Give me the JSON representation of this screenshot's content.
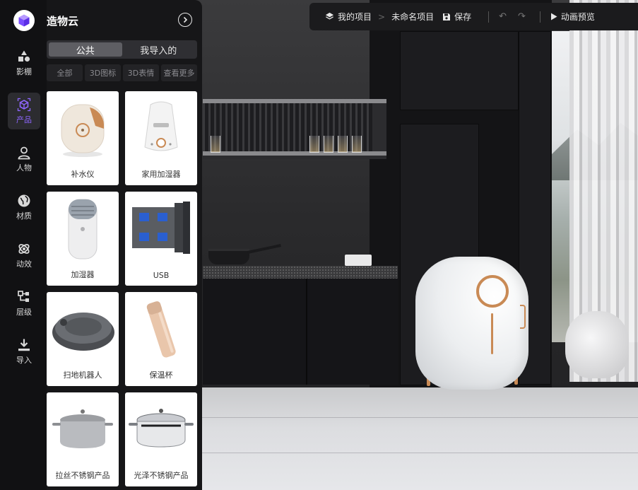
{
  "app": {
    "name": "造物云"
  },
  "toolbar": {
    "my_projects": "我的项目",
    "separator": ">",
    "project_name": "未命名项目",
    "save": "保存",
    "undo_icon": "undo-icon",
    "redo_icon": "redo-icon",
    "preview": "动画预览"
  },
  "rail": {
    "items": [
      {
        "label": "影棚",
        "icon": "studio-shapes-icon",
        "active": false
      },
      {
        "label": "产品",
        "icon": "product-cube-icon",
        "active": true
      },
      {
        "label": "人物",
        "icon": "person-icon",
        "active": false
      },
      {
        "label": "材质",
        "icon": "material-globe-icon",
        "active": false
      },
      {
        "label": "动效",
        "icon": "motion-rings-icon",
        "active": false
      },
      {
        "label": "层级",
        "icon": "hierarchy-icon",
        "active": false
      },
      {
        "label": "导入",
        "icon": "import-download-icon",
        "active": false
      }
    ],
    "accent_color": "#8e66ff"
  },
  "panel": {
    "tabs": [
      {
        "label": "公共",
        "active": true
      },
      {
        "label": "我导入的",
        "active": false
      }
    ],
    "filters": [
      "全部",
      "3D图标",
      "3D表情",
      "查看更多"
    ],
    "products": [
      {
        "label": "补水仪"
      },
      {
        "label": "家用加湿器"
      },
      {
        "label": "加湿器"
      },
      {
        "label": "USB"
      },
      {
        "label": "扫地机器人"
      },
      {
        "label": "保温杯"
      },
      {
        "label": "拉丝不锈钢产品"
      },
      {
        "label": "光泽不锈钢产品"
      }
    ]
  }
}
